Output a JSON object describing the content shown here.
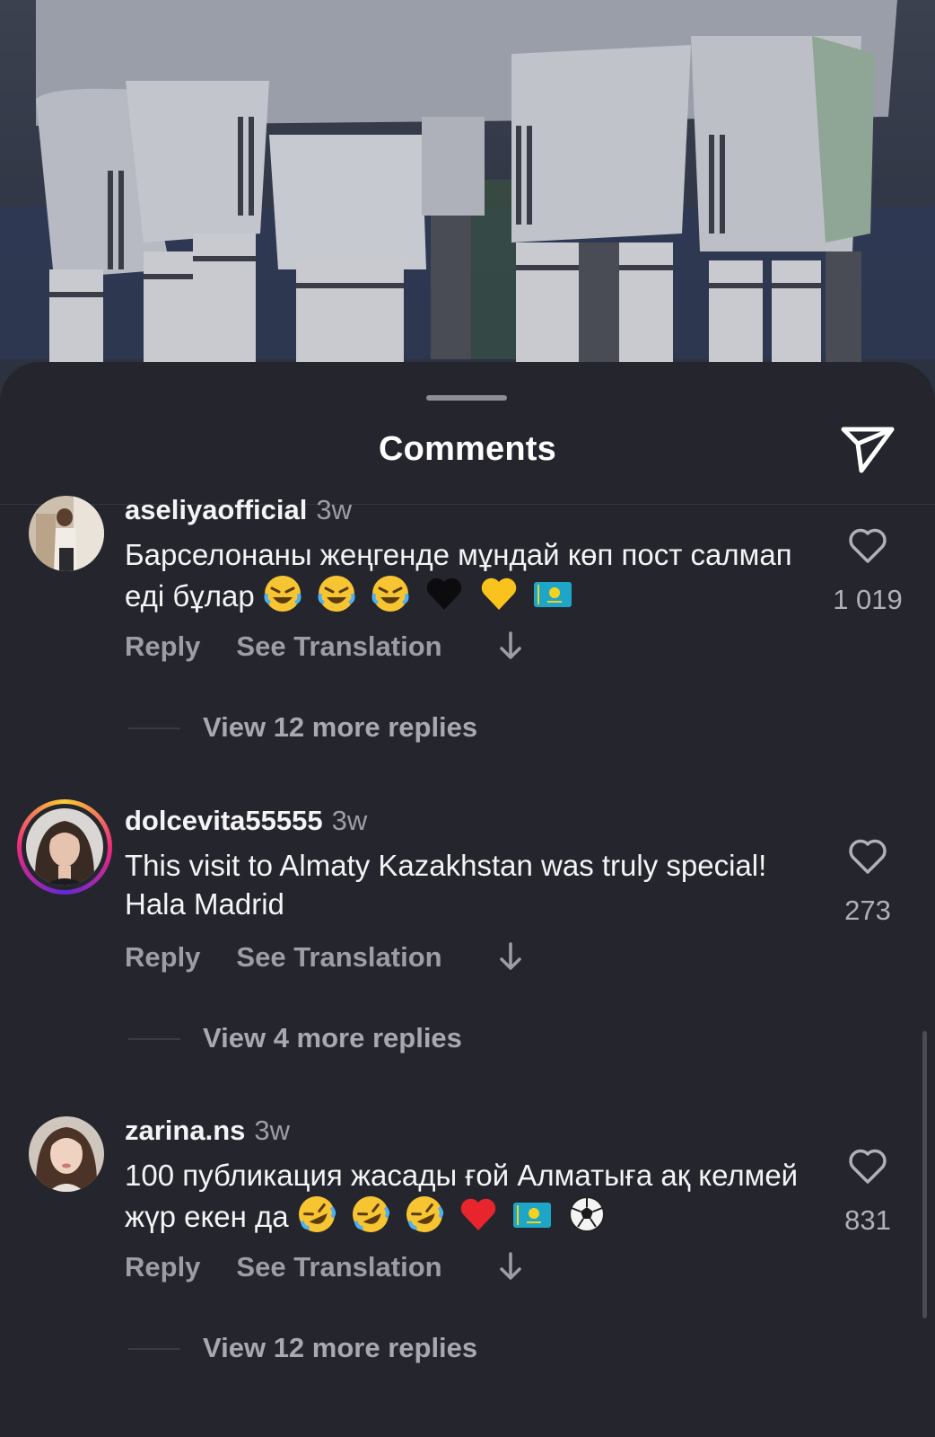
{
  "sheet": {
    "title": "Comments"
  },
  "comments": [
    {
      "username": "aseliyaofficial",
      "time": "3w",
      "text": "Барселонаны жеңгенде мұндай көп пост салмап еді бұлар",
      "emojis": [
        "laughing-icon",
        "laughing-icon",
        "laughing-icon",
        "black-heart-icon",
        "yellow-heart-icon",
        "kazakhstan-flag-icon"
      ],
      "likes": "1 019",
      "reply_label": "Reply",
      "translation_label": "See Translation",
      "replies_label": "View 12 more replies"
    },
    {
      "username": "dolcevita55555",
      "time": "3w",
      "text": "This visit to Almaty Kazakhstan was truly special! Hala Madrid",
      "emojis": [],
      "likes": "273",
      "reply_label": "Reply",
      "translation_label": "See Translation",
      "replies_label": "View 4 more replies"
    },
    {
      "username": "zarina.ns",
      "time": "3w",
      "text": "100 публикация жасады ғой Алматыға ақ келмей жүр екен да",
      "emojis": [
        "rofl-icon",
        "rofl-icon",
        "rofl-icon",
        "red-heart-icon",
        "kazakhstan-flag-icon",
        "soccer-ball-icon"
      ],
      "likes": "831",
      "reply_label": "Reply",
      "translation_label": "See Translation",
      "replies_label": "View 12 more replies"
    }
  ],
  "colors": {
    "sheet_bg": "#25262d",
    "secondary_text": "#9c9da6",
    "story_ring": "#ee2a7b"
  }
}
